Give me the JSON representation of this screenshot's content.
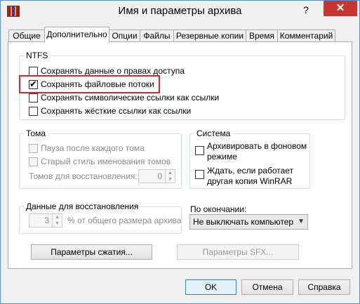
{
  "window": {
    "title": "Имя и параметры архива",
    "help_label": "?",
    "close_label": "✕"
  },
  "tabs": [
    {
      "label": "Общие"
    },
    {
      "label": "Дополнительно"
    },
    {
      "label": "Опции"
    },
    {
      "label": "Файлы"
    },
    {
      "label": "Резервные копии"
    },
    {
      "label": "Время"
    },
    {
      "label": "Комментарий"
    }
  ],
  "ntfs": {
    "legend": "NTFS",
    "options": [
      {
        "label": "Сохранять данные о правах доступа",
        "checked": false
      },
      {
        "label": "Сохранять файловые потоки",
        "checked": true
      },
      {
        "label": "Сохранять символические ссылки как ссылки",
        "checked": false
      },
      {
        "label": "Сохранять жёсткие ссылки как ссылки",
        "checked": false
      }
    ]
  },
  "volumes": {
    "legend": "Тома",
    "pause_label": "Пауза после каждого тома",
    "old_naming_label": "Старый стиль именования томов",
    "recovery_label": "Томов для восстановления:",
    "recovery_value": "0"
  },
  "system": {
    "legend": "Система",
    "background_label_1": "Архивировать в фоновом",
    "background_label_2": "режиме",
    "wait_label_1": "Ждать, если работает",
    "wait_label_2": "другая копия WinRAR"
  },
  "recovery": {
    "legend": "Данные для восстановления",
    "value": "3",
    "suffix": "% от общего размера архива"
  },
  "on_finish": {
    "label": "По окончании:",
    "selected": "Не выключать компьютер"
  },
  "buttons": {
    "compression": "Параметры сжатия...",
    "sfx": "Параметры SFX...",
    "ok": "OK",
    "cancel": "Отмена",
    "help": "Справка"
  }
}
